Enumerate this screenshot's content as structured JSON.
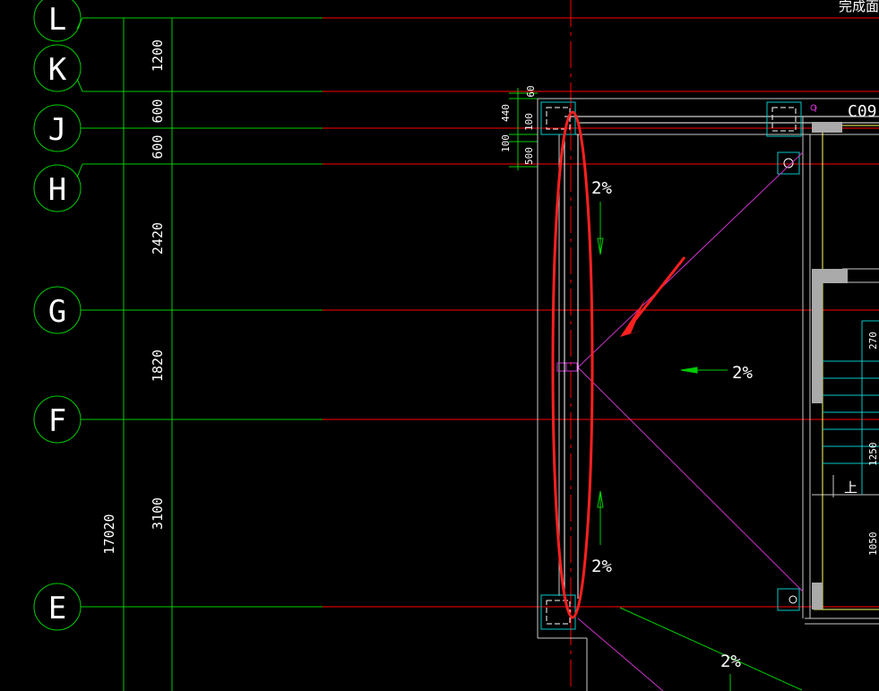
{
  "colors": {
    "background": "#000000",
    "axis_line": "#ff0000",
    "dim_line": "#00cc00",
    "text": "#ffffff",
    "wall": "#c8c8c8",
    "purple": "#cc33cc",
    "cyan": "#00c8c8",
    "yellow": "#ffff66",
    "highlight": "#ff2020"
  },
  "axes": [
    {
      "label": "L"
    },
    {
      "label": "K"
    },
    {
      "label": "J"
    },
    {
      "label": "H"
    },
    {
      "label": "G"
    },
    {
      "label": "F"
    },
    {
      "label": "E"
    }
  ],
  "dimensions": {
    "segments": [
      "1200",
      "600",
      "600",
      "2420",
      "1820",
      "3100"
    ],
    "total": "17020",
    "small": [
      "60",
      "440",
      "100",
      "100",
      "500"
    ]
  },
  "slopes": [
    "2%",
    "2%",
    "2%",
    "2%"
  ],
  "partial_labels": {
    "top_right": "完成面",
    "window": "C09",
    "stair_up": "上",
    "dim_a": "270",
    "dim_b": "1250",
    "dim_c": "1050"
  },
  "annotation": {
    "shape": "ellipse-arrow"
  }
}
